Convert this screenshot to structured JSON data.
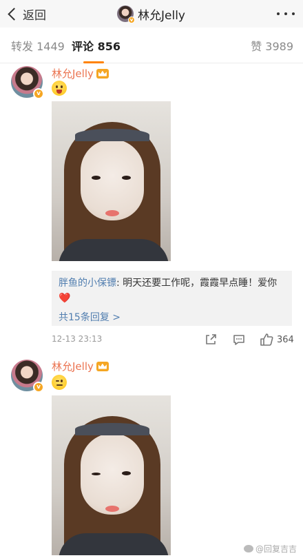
{
  "nav": {
    "back_label": "返回",
    "title": "林允Jelly",
    "more_icon": "ellipsis-icon"
  },
  "tabs": [
    {
      "label": "转发 1449",
      "active": false
    },
    {
      "label": "评论 856",
      "active": true
    },
    {
      "label": "赞 3989",
      "active": false
    }
  ],
  "colors": {
    "accent": "#ff8200",
    "username": "#eb7350",
    "link": "#507daf",
    "verified_badge": "#f5a623"
  },
  "comments": [
    {
      "user": "林允Jelly",
      "emoji": "tongue-out-emoji",
      "image": "selfie-photo",
      "reply": {
        "user": "胖鱼的小保镖",
        "text": ": 明天还要工作呢，霞霞早点睡！爱你",
        "heart": "❤️",
        "more": "共15条回复 >"
      },
      "time": "12-13 23:13",
      "likes": "364"
    },
    {
      "user": "林允Jelly",
      "emoji": "wink-emoji",
      "image": "selfie-photo"
    }
  ],
  "watermark": "@回复吉吉"
}
